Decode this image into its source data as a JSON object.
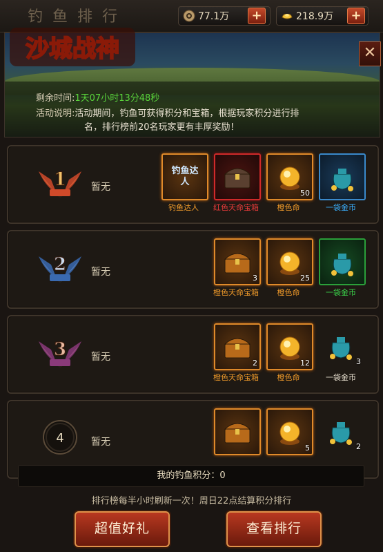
{
  "header": {
    "tab_title": "钓鱼排行",
    "copper": "77.1万",
    "gold": "218.9万"
  },
  "banner": {
    "logo_text": "沙城战神",
    "remaining_label": "剩余时间:",
    "remaining_value": "1天07小时13分48秒",
    "desc_label": "活动说明:",
    "desc_line1": "活动期间，钓鱼可获得积分和宝箱，根据玩家积分进行排",
    "desc_line2": "名，排行榜前20名玩家更有丰厚奖励！"
  },
  "ranks": [
    {
      "rank": "1",
      "player": "暂无",
      "rewards": [
        {
          "name": "钓鱼达人",
          "title_glyph": "钓鱼达人",
          "count": "",
          "color": "orange"
        },
        {
          "name": "红色天命宝箱",
          "count": "",
          "color": "red"
        },
        {
          "name": "橙色命",
          "count": "50",
          "color": "orange"
        },
        {
          "name": "一袋金币",
          "count": "",
          "color": "blue"
        }
      ]
    },
    {
      "rank": "2",
      "player": "暂无",
      "rewards": [
        {
          "name": "橙色天命宝箱",
          "count": "3",
          "color": "orange"
        },
        {
          "name": "橙色命",
          "count": "25",
          "color": "orange"
        },
        {
          "name": "一袋金币",
          "count": "",
          "color": "green"
        }
      ]
    },
    {
      "rank": "3",
      "player": "暂无",
      "rewards": [
        {
          "name": "橙色天命宝箱",
          "count": "2",
          "color": "orange"
        },
        {
          "name": "橙色命",
          "count": "12",
          "color": "orange"
        },
        {
          "name": "一袋金币",
          "count": "3",
          "color": "white"
        }
      ]
    },
    {
      "rank": "4",
      "player": "暂无",
      "rewards": [
        {
          "name": "",
          "count": "",
          "color": "orange"
        },
        {
          "name": "",
          "count": "5",
          "color": "orange"
        },
        {
          "name": "",
          "count": "2",
          "color": "white"
        }
      ]
    }
  ],
  "footer": {
    "my_score_label": "我的钓鱼积分：0",
    "notice": "排行榜每半小时刷新一次！周日22点结算积分排行",
    "gift_button": "超值好礼",
    "view_rank_button": "查看排行"
  },
  "icons": {
    "copper": "copper-coin-icon",
    "gold": "gold-ingot-icon",
    "close": "close-icon"
  }
}
